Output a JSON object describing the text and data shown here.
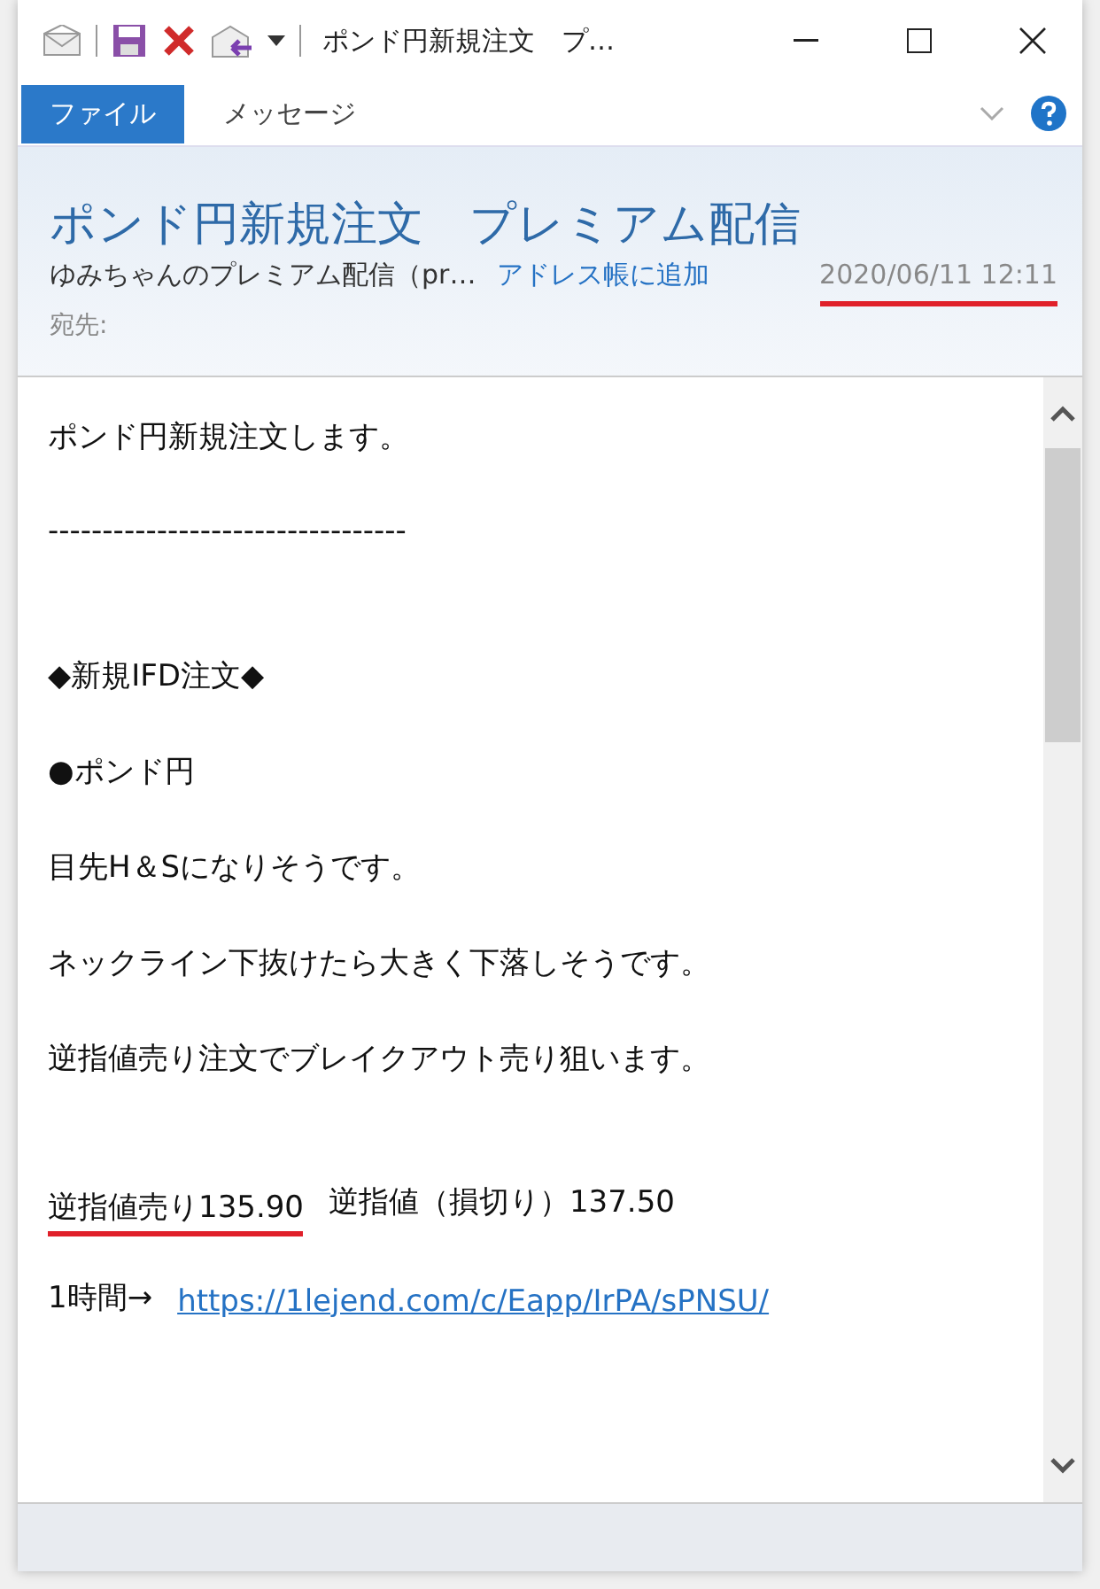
{
  "window": {
    "title": "ポンド円新規注文　プ…"
  },
  "ribbon": {
    "tabs": [
      {
        "label": "ファイル",
        "selected": true
      },
      {
        "label": "メッセージ",
        "selected": false
      }
    ]
  },
  "header": {
    "subject": "ポンド円新規注文　プレミアム配信",
    "sender": "ゆみちゃんのプレミアム配信（pr…",
    "add_contact": "アドレス帳に追加",
    "date": "2020/06/11 12:11",
    "date_underlined": true,
    "to_label": "宛先:"
  },
  "body": {
    "lines": [
      {
        "kind": "text",
        "segments": [
          {
            "kind": "plain",
            "text": "ポンド円新規注文します。"
          }
        ]
      },
      {
        "kind": "blank"
      },
      {
        "kind": "text",
        "segments": [
          {
            "kind": "plain",
            "text": "---------------------------------"
          }
        ]
      },
      {
        "kind": "blank"
      },
      {
        "kind": "blank"
      },
      {
        "kind": "text",
        "segments": [
          {
            "kind": "plain",
            "text": "◆新規IFD注文◆"
          }
        ]
      },
      {
        "kind": "blank"
      },
      {
        "kind": "text",
        "segments": [
          {
            "kind": "plain",
            "text": "●ポンド円"
          }
        ]
      },
      {
        "kind": "blank"
      },
      {
        "kind": "text",
        "segments": [
          {
            "kind": "plain",
            "text": "目先H＆Sになりそうです。"
          }
        ]
      },
      {
        "kind": "blank"
      },
      {
        "kind": "text",
        "segments": [
          {
            "kind": "plain",
            "text": "ネックライン下抜けたら大きく下落しそうです。"
          }
        ]
      },
      {
        "kind": "blank"
      },
      {
        "kind": "text",
        "segments": [
          {
            "kind": "plain",
            "text": "逆指値売り注文でブレイクアウト売り狙います。"
          }
        ]
      },
      {
        "kind": "blank"
      },
      {
        "kind": "blank"
      },
      {
        "kind": "text",
        "segments": [
          {
            "kind": "underlined",
            "text": "逆指値売り135.90"
          },
          {
            "kind": "plain",
            "text": "逆指値（損切り）137.50"
          }
        ]
      },
      {
        "kind": "blank"
      },
      {
        "kind": "text",
        "segments": [
          {
            "kind": "plain",
            "text": "1時間→"
          },
          {
            "kind": "link",
            "text": "https://1lejend.com/c/Eapp/IrPA/sPNSU/"
          }
        ]
      }
    ]
  }
}
